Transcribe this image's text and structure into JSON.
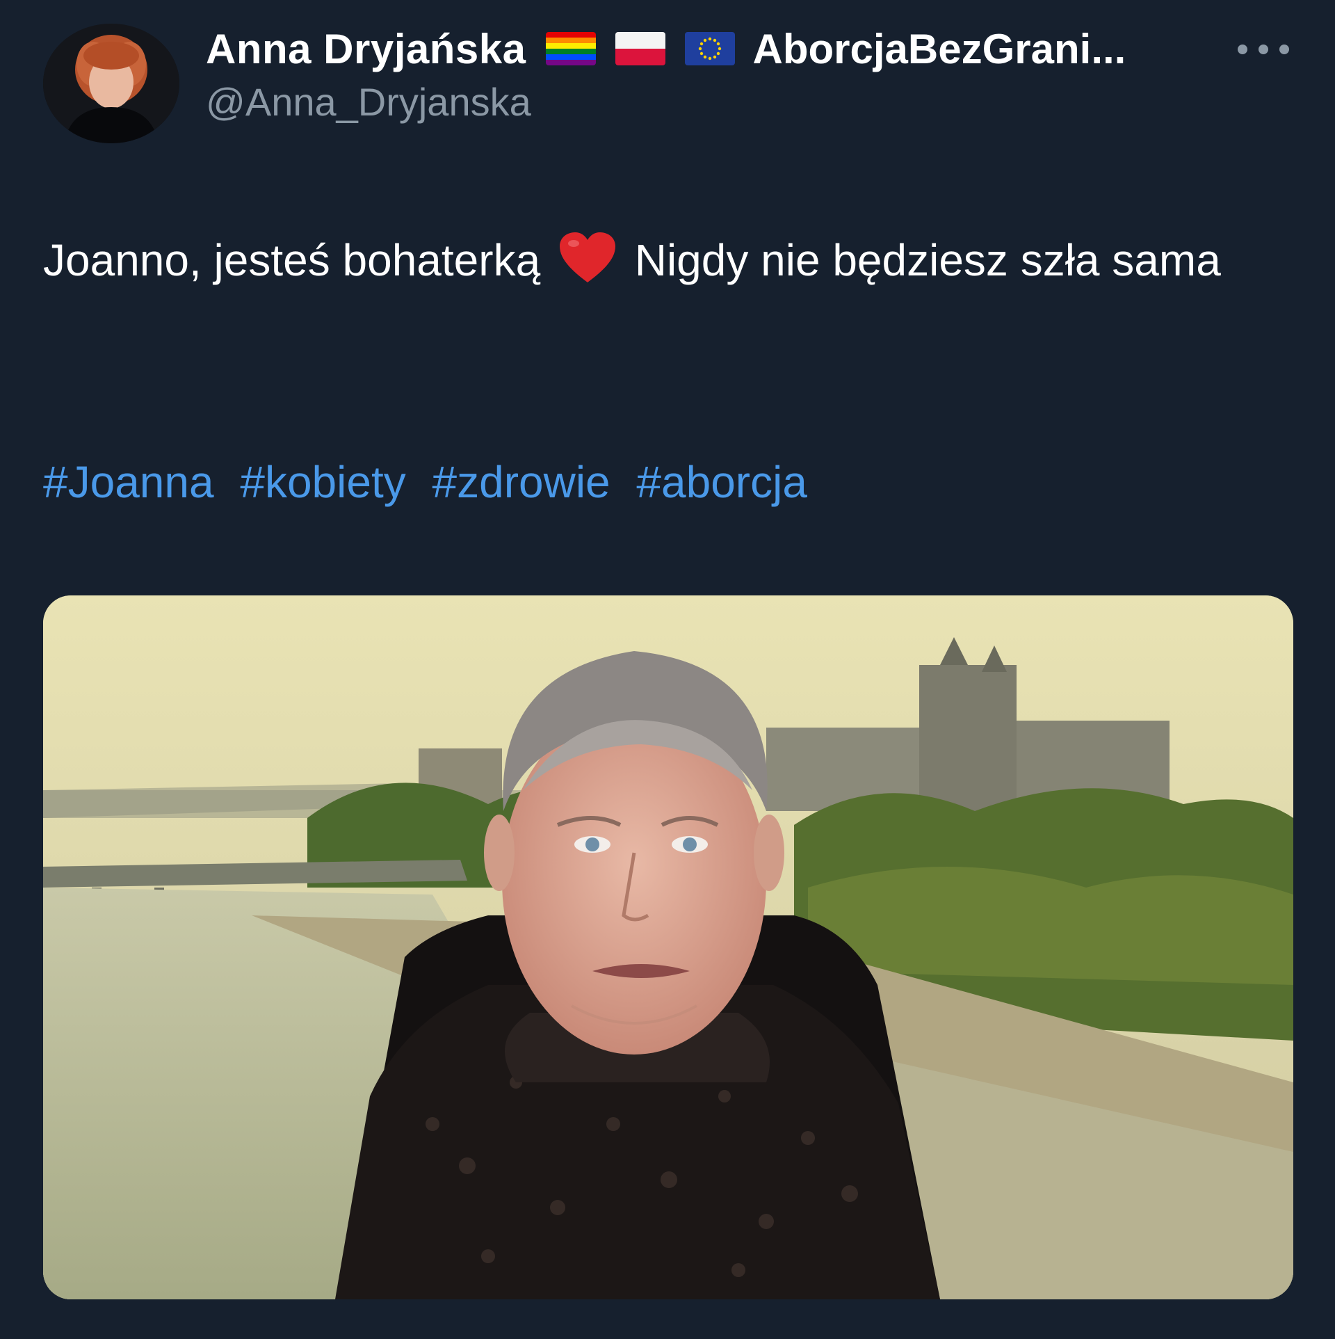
{
  "author": {
    "display_name": "Anna Dryjańska",
    "name_suffix": "AborcjaBezGrani...",
    "handle": "@Anna_Dryjanska",
    "flags": [
      "rainbow-flag",
      "poland-flag",
      "eu-flag"
    ]
  },
  "tweet": {
    "text_before_emoji": "Joanno, jesteś bohaterką",
    "emoji": "red-heart",
    "text_after_emoji": "Nigdy nie będziesz szła sama",
    "hashtags": [
      "#Joanna",
      "#kobiety",
      "#zdrowie",
      "#aborcja"
    ]
  },
  "colors": {
    "background": "#16202e",
    "hashtag": "#4a99e9",
    "secondary_text": "#8b98a5"
  }
}
